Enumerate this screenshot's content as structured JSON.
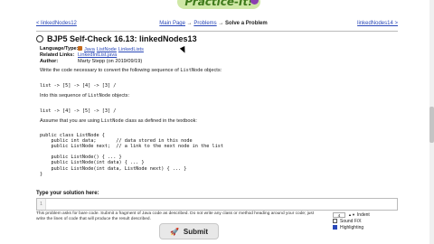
{
  "header": {
    "logo_text": "Practice-It!",
    "prev_link": "< linkedNodes12",
    "next_link": "linkedNodes14 >",
    "crumb_main": "Main Page",
    "crumb_sep": " → ",
    "crumb_problems": "Problems",
    "crumb_current": "Solve a Problem"
  },
  "problem": {
    "title": "BJP5 Self-Check 16.13: linkedNodes13",
    "meta": {
      "language_label": "Language/Type:",
      "language_items": [
        "Java",
        "ListNode",
        "LinkedLists"
      ],
      "related_label": "Related Links:",
      "related_link": "LinkedIntList.java",
      "author_label": "Author:",
      "author_value": "Marty Stepp (on 2019/09/19)"
    },
    "intro": "Write the code necessary to convert the following sequence of",
    "intro_code": "ListNode",
    "intro_tail": "objects:",
    "sequence_before": "list -> [5] -> [4] -> [3] /",
    "into_text": "Into this sequence of",
    "into_code": "ListNode",
    "into_tail": "objects:",
    "sequence_after": "list -> [4] -> [5] -> [3] /",
    "assume_text": "Assume that you are using",
    "assume_code": "ListNode",
    "assume_tail": "class as defined in the textbook:",
    "class_code": "public class ListNode {\n    public int data;       // data stored in this node\n    public ListNode next;  // a link to the next node in the list\n\n    public ListNode() { ... }\n    public ListNode(int data) { ... }\n    public ListNode(int data, ListNode next) { ... }\n}"
  },
  "answer": {
    "label": "Type your solution here:",
    "line_number": "1",
    "note": "This problem asks for bare code. Submit a fragment of Java code as described. Do not write any class or method heading around your code; just write the lines of code that will produce the result described."
  },
  "submit": {
    "label": "Submit"
  },
  "controls": {
    "indent_value": "4",
    "indent_label": "Indent",
    "sound_label": "Sound F/X",
    "sound_checked": false,
    "highlight_label": "Highlighting",
    "highlight_checked": true
  }
}
